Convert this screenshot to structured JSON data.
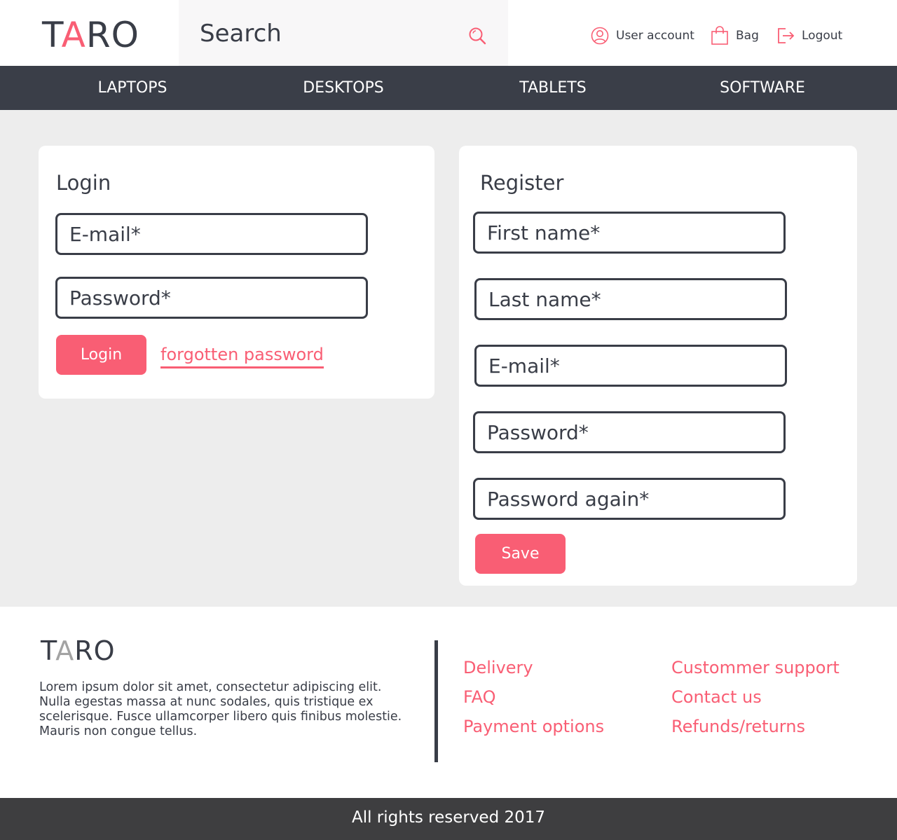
{
  "brand": {
    "logo_first": "T",
    "logo_accent": "A",
    "logo_rest": "RO",
    "accent_color": "#f95e74",
    "dark_color": "#393d47"
  },
  "header": {
    "search_placeholder": "Search",
    "search_icon": "search-icon",
    "user_account_label": "User account",
    "bag_label": "Bag",
    "logout_label": "Logout"
  },
  "nav": {
    "items": [
      {
        "label": "LAPTOPS"
      },
      {
        "label": "DESKTOPS"
      },
      {
        "label": "TABLETS"
      },
      {
        "label": "SOFTWARE"
      }
    ]
  },
  "login": {
    "title": "Login",
    "email_placeholder": "E-mail*",
    "password_placeholder": "Password*",
    "submit_label": "Login",
    "forgot_label": "forgotten password"
  },
  "register": {
    "title": "Register",
    "first_name_placeholder": "First name*",
    "last_name_placeholder": "Last name*",
    "email_placeholder": "E-mail*",
    "password_placeholder": "Password*",
    "password_again_placeholder": "Password again*",
    "save_label": "Save"
  },
  "footer": {
    "logo_first": "T",
    "logo_accent": "A",
    "logo_rest": "RO",
    "text": "Lorem ipsum dolor sit amet, consectetur adipiscing elit. Nulla egestas massa at nunc sodales, quis tristique ex scelerisque. Fusce ullamcorper libero quis finibus molestie. Mauris non congue tellus.",
    "links_left": [
      "Delivery",
      "FAQ",
      "Payment options"
    ],
    "links_right": [
      "Custommer support",
      "Contact us",
      "Refunds/returns"
    ],
    "copyright": "All rights reserved 2017"
  }
}
